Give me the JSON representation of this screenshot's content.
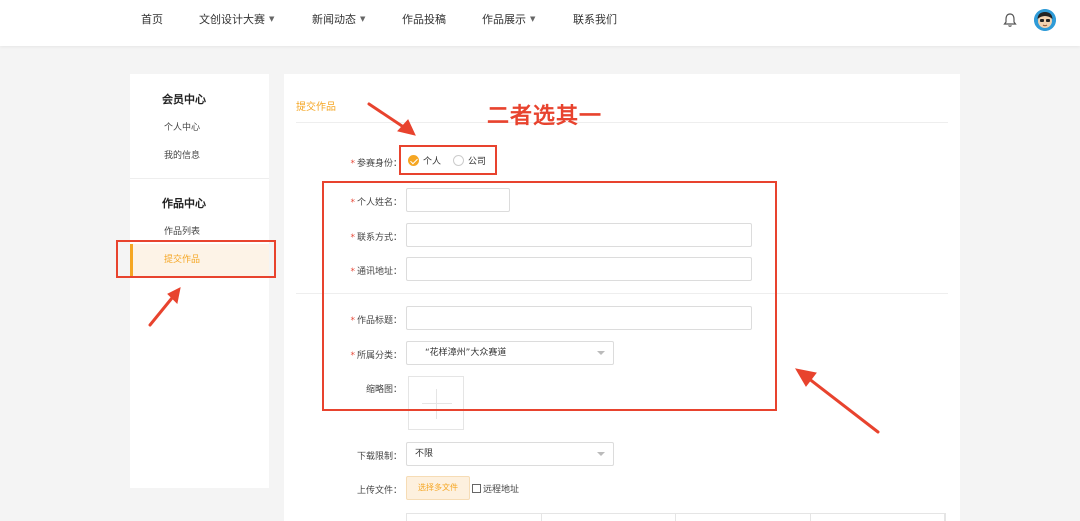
{
  "nav": {
    "items": [
      {
        "label": "首页",
        "dropdown": false
      },
      {
        "label": "文创设计大赛",
        "dropdown": true
      },
      {
        "label": "新闻动态",
        "dropdown": true
      },
      {
        "label": "作品投稿",
        "dropdown": false
      },
      {
        "label": "作品展示",
        "dropdown": true
      },
      {
        "label": "联系我们",
        "dropdown": false
      }
    ],
    "bell_icon": "bell-icon",
    "avatar_icon": "avatar-icon"
  },
  "sidebar": {
    "section1_title": "会员中心",
    "section1_items": [
      "个人中心",
      "我的信息"
    ],
    "section2_title": "作品中心",
    "section2_items": [
      "作品列表",
      "提交作品"
    ],
    "active_item": "提交作品"
  },
  "form": {
    "title": "提交作品",
    "identity_label": "参赛身份：",
    "identity_options": [
      "个人",
      "公司"
    ],
    "identity_selected": "个人",
    "name_label": "个人姓名：",
    "name_value": "",
    "contact_label": "联系方式：",
    "contact_value": "",
    "address_label": "通讯地址：",
    "address_value": "",
    "work_title_label": "作品标题：",
    "work_title_value": "",
    "category_label": "所属分类：",
    "category_value": "“花样漳州”大众赛道",
    "thumbnail_label": "缩略图：",
    "download_label": "下载限制：",
    "download_value": "不限",
    "upload_label": "上传文件：",
    "upload_button": "选择多文件",
    "remote_label": "远程地址",
    "remote_checked": false
  },
  "annotation": {
    "text": "二者选其一",
    "color": "#e8432e"
  },
  "colors": {
    "accent": "#f5a623",
    "required": "#e74c3c"
  }
}
